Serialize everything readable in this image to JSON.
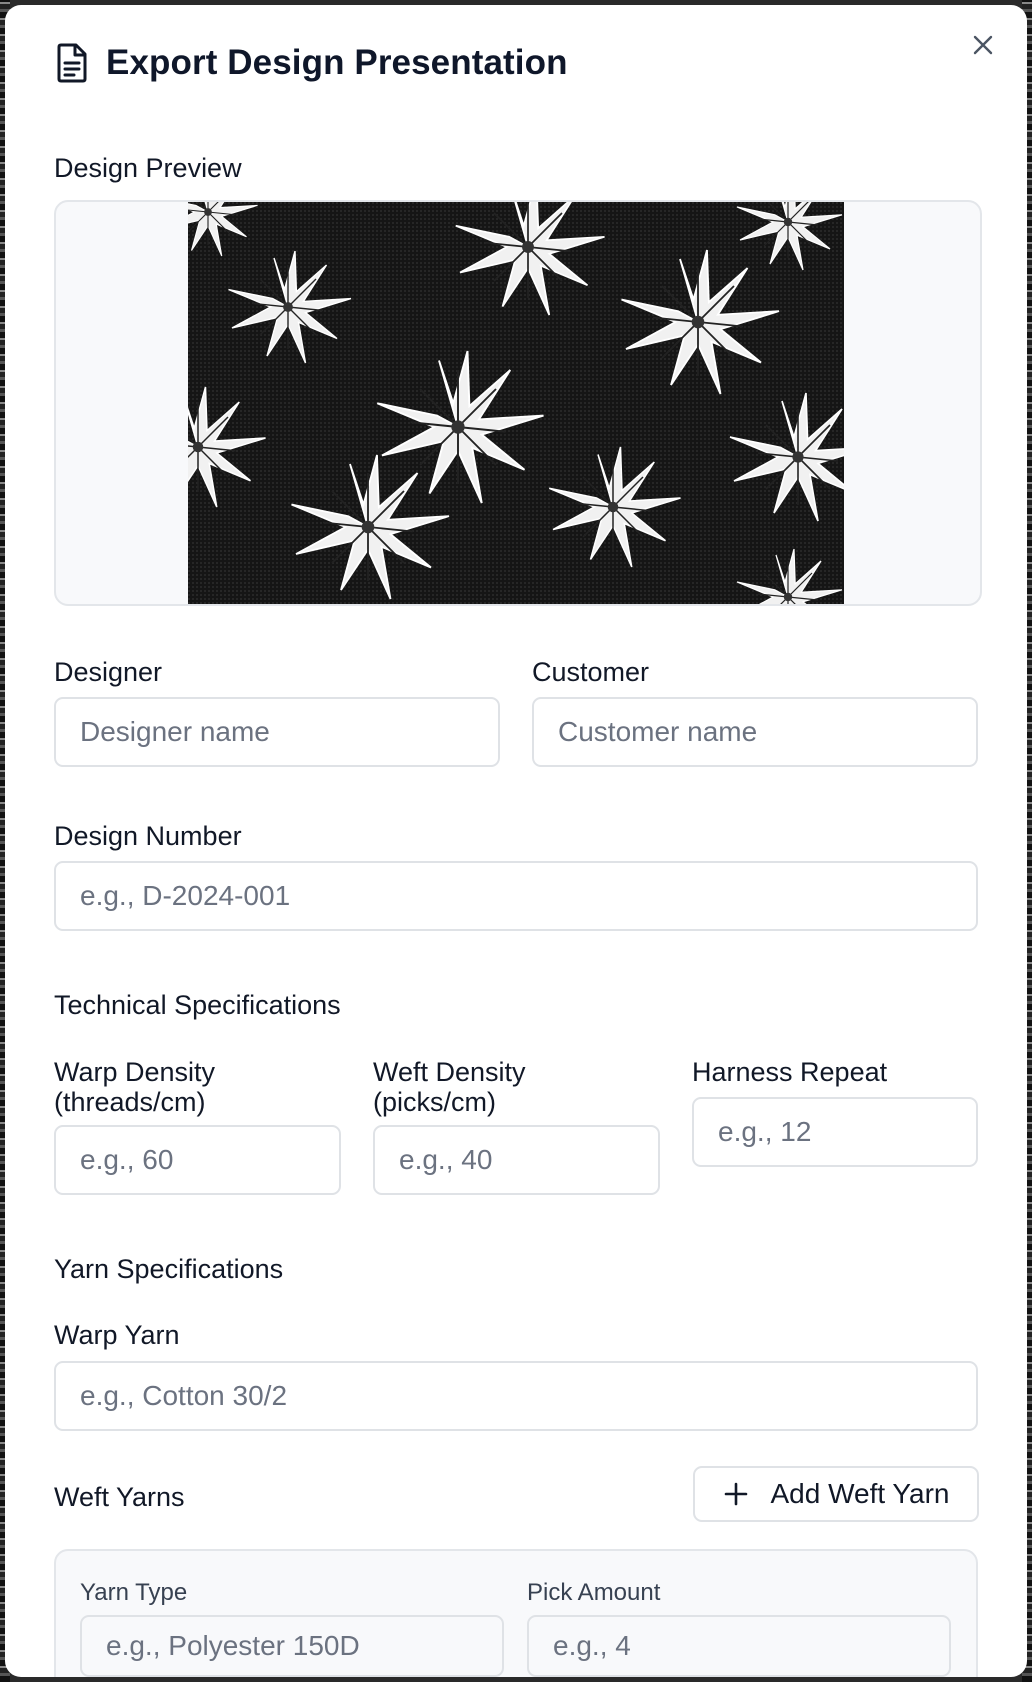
{
  "dialog": {
    "title": "Export Design Presentation",
    "icon": "document-icon",
    "close_icon": "close-icon"
  },
  "preview": {
    "label": "Design Preview"
  },
  "designer": {
    "label": "Designer",
    "placeholder": "Designer name",
    "value": ""
  },
  "customer": {
    "label": "Customer",
    "placeholder": "Customer name",
    "value": ""
  },
  "design_number": {
    "label": "Design Number",
    "placeholder": "e.g., D-2024-001",
    "value": ""
  },
  "technical": {
    "heading": "Technical Specifications",
    "warp_density": {
      "label": "Warp Density (threads/cm)",
      "placeholder": "e.g., 60"
    },
    "weft_density": {
      "label": "Weft Density (picks/cm)",
      "placeholder": "e.g., 40"
    },
    "harness_repeat": {
      "label": "Harness Repeat",
      "placeholder": "e.g., 12"
    }
  },
  "yarn": {
    "heading": "Yarn Specifications",
    "warp_yarn": {
      "label": "Warp Yarn",
      "placeholder": "e.g., Cotton 30/2"
    },
    "weft_yarns_label": "Weft Yarns",
    "add_weft_label": "Add Weft Yarn",
    "weft_items": [
      {
        "yarn_type_label": "Yarn Type",
        "yarn_type_placeholder": "e.g., Polyester 150D",
        "pick_amount_label": "Pick Amount",
        "pick_amount_placeholder": "e.g., 4"
      }
    ]
  },
  "colors": {
    "border": "#dfe2e6",
    "card_bg": "#f8f9fb",
    "placeholder": "#6b7280",
    "text": "#111827"
  }
}
